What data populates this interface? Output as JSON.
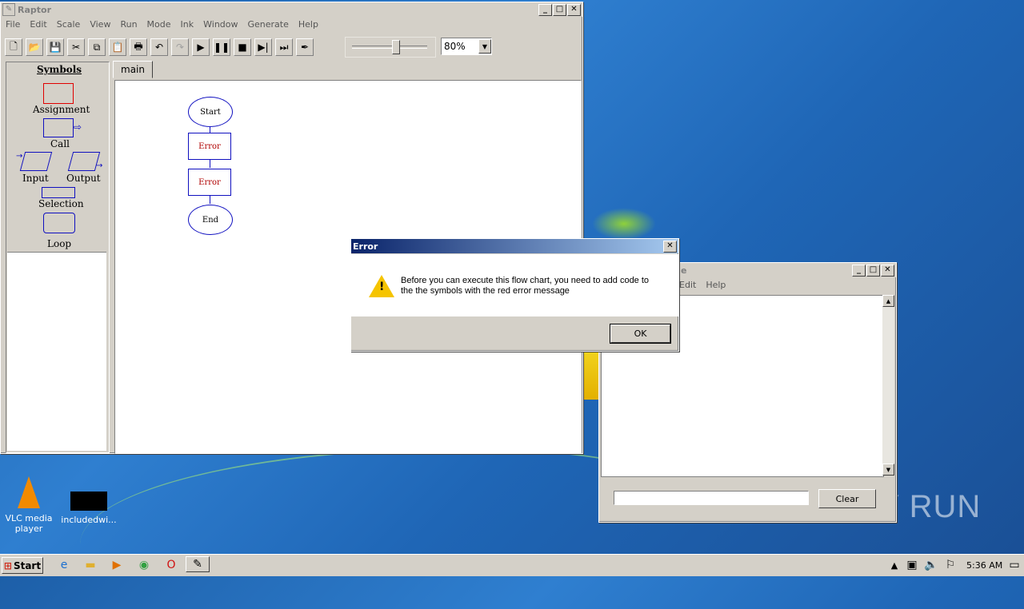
{
  "raptor": {
    "title": "Raptor",
    "menu": [
      "File",
      "Edit",
      "Scale",
      "View",
      "Run",
      "Mode",
      "Ink",
      "Window",
      "Generate",
      "Help"
    ],
    "zoom": "80%",
    "slider_position": 0.57,
    "symbols_header": "Symbols",
    "symbols": {
      "assignment": "Assignment",
      "call": "Call",
      "input": "Input",
      "output": "Output",
      "selection": "Selection",
      "loop": "Loop"
    },
    "tab": "main",
    "flowchart": {
      "start": "Start",
      "error1": "Error",
      "error2": "Error",
      "end": "End"
    },
    "colors": {
      "error_red": "#b00000",
      "flow_blue": "#1010c0"
    }
  },
  "console": {
    "title": "e",
    "menu": [
      "Edit",
      "Help"
    ],
    "clear_label": "Clear",
    "input_value": ""
  },
  "dialog": {
    "title": "Error",
    "message_line1": "Before you can execute this flow chart, you need to add code to",
    "message_line2": "the the symbols with the red error message",
    "ok_label": "OK",
    "icon": "warning-icon"
  },
  "desktop": {
    "icons": [
      {
        "label_line1": "VLC media",
        "label_line2": "player"
      },
      {
        "label_line1": "includedwi...",
        "label_line2": ""
      }
    ],
    "watermark": "ANY RUN"
  },
  "taskbar": {
    "start_label": "Start",
    "clock": "5:36 AM"
  }
}
